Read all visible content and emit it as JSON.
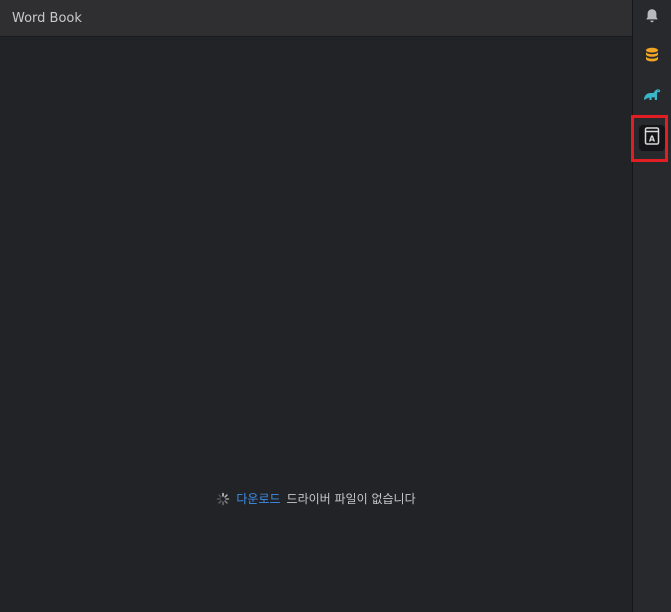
{
  "panel": {
    "title": "Word Book"
  },
  "empty_state": {
    "link_text": "다운로드",
    "message": "드라이버 파일이 없습니다",
    "icon": "spinner-icon"
  },
  "sidebar": {
    "items": [
      {
        "name": "notifications",
        "icon": "bell-icon",
        "color": "#b9babd"
      },
      {
        "name": "database",
        "icon": "database-icon",
        "color": "#f0a527"
      },
      {
        "name": "dinosaur",
        "icon": "dinosaur-icon",
        "color": "#3ab6c9"
      },
      {
        "name": "word-book",
        "icon": "word-book-icon",
        "color": "#d9d9dc",
        "active": true
      }
    ],
    "highlight_color": "#e21d24"
  }
}
